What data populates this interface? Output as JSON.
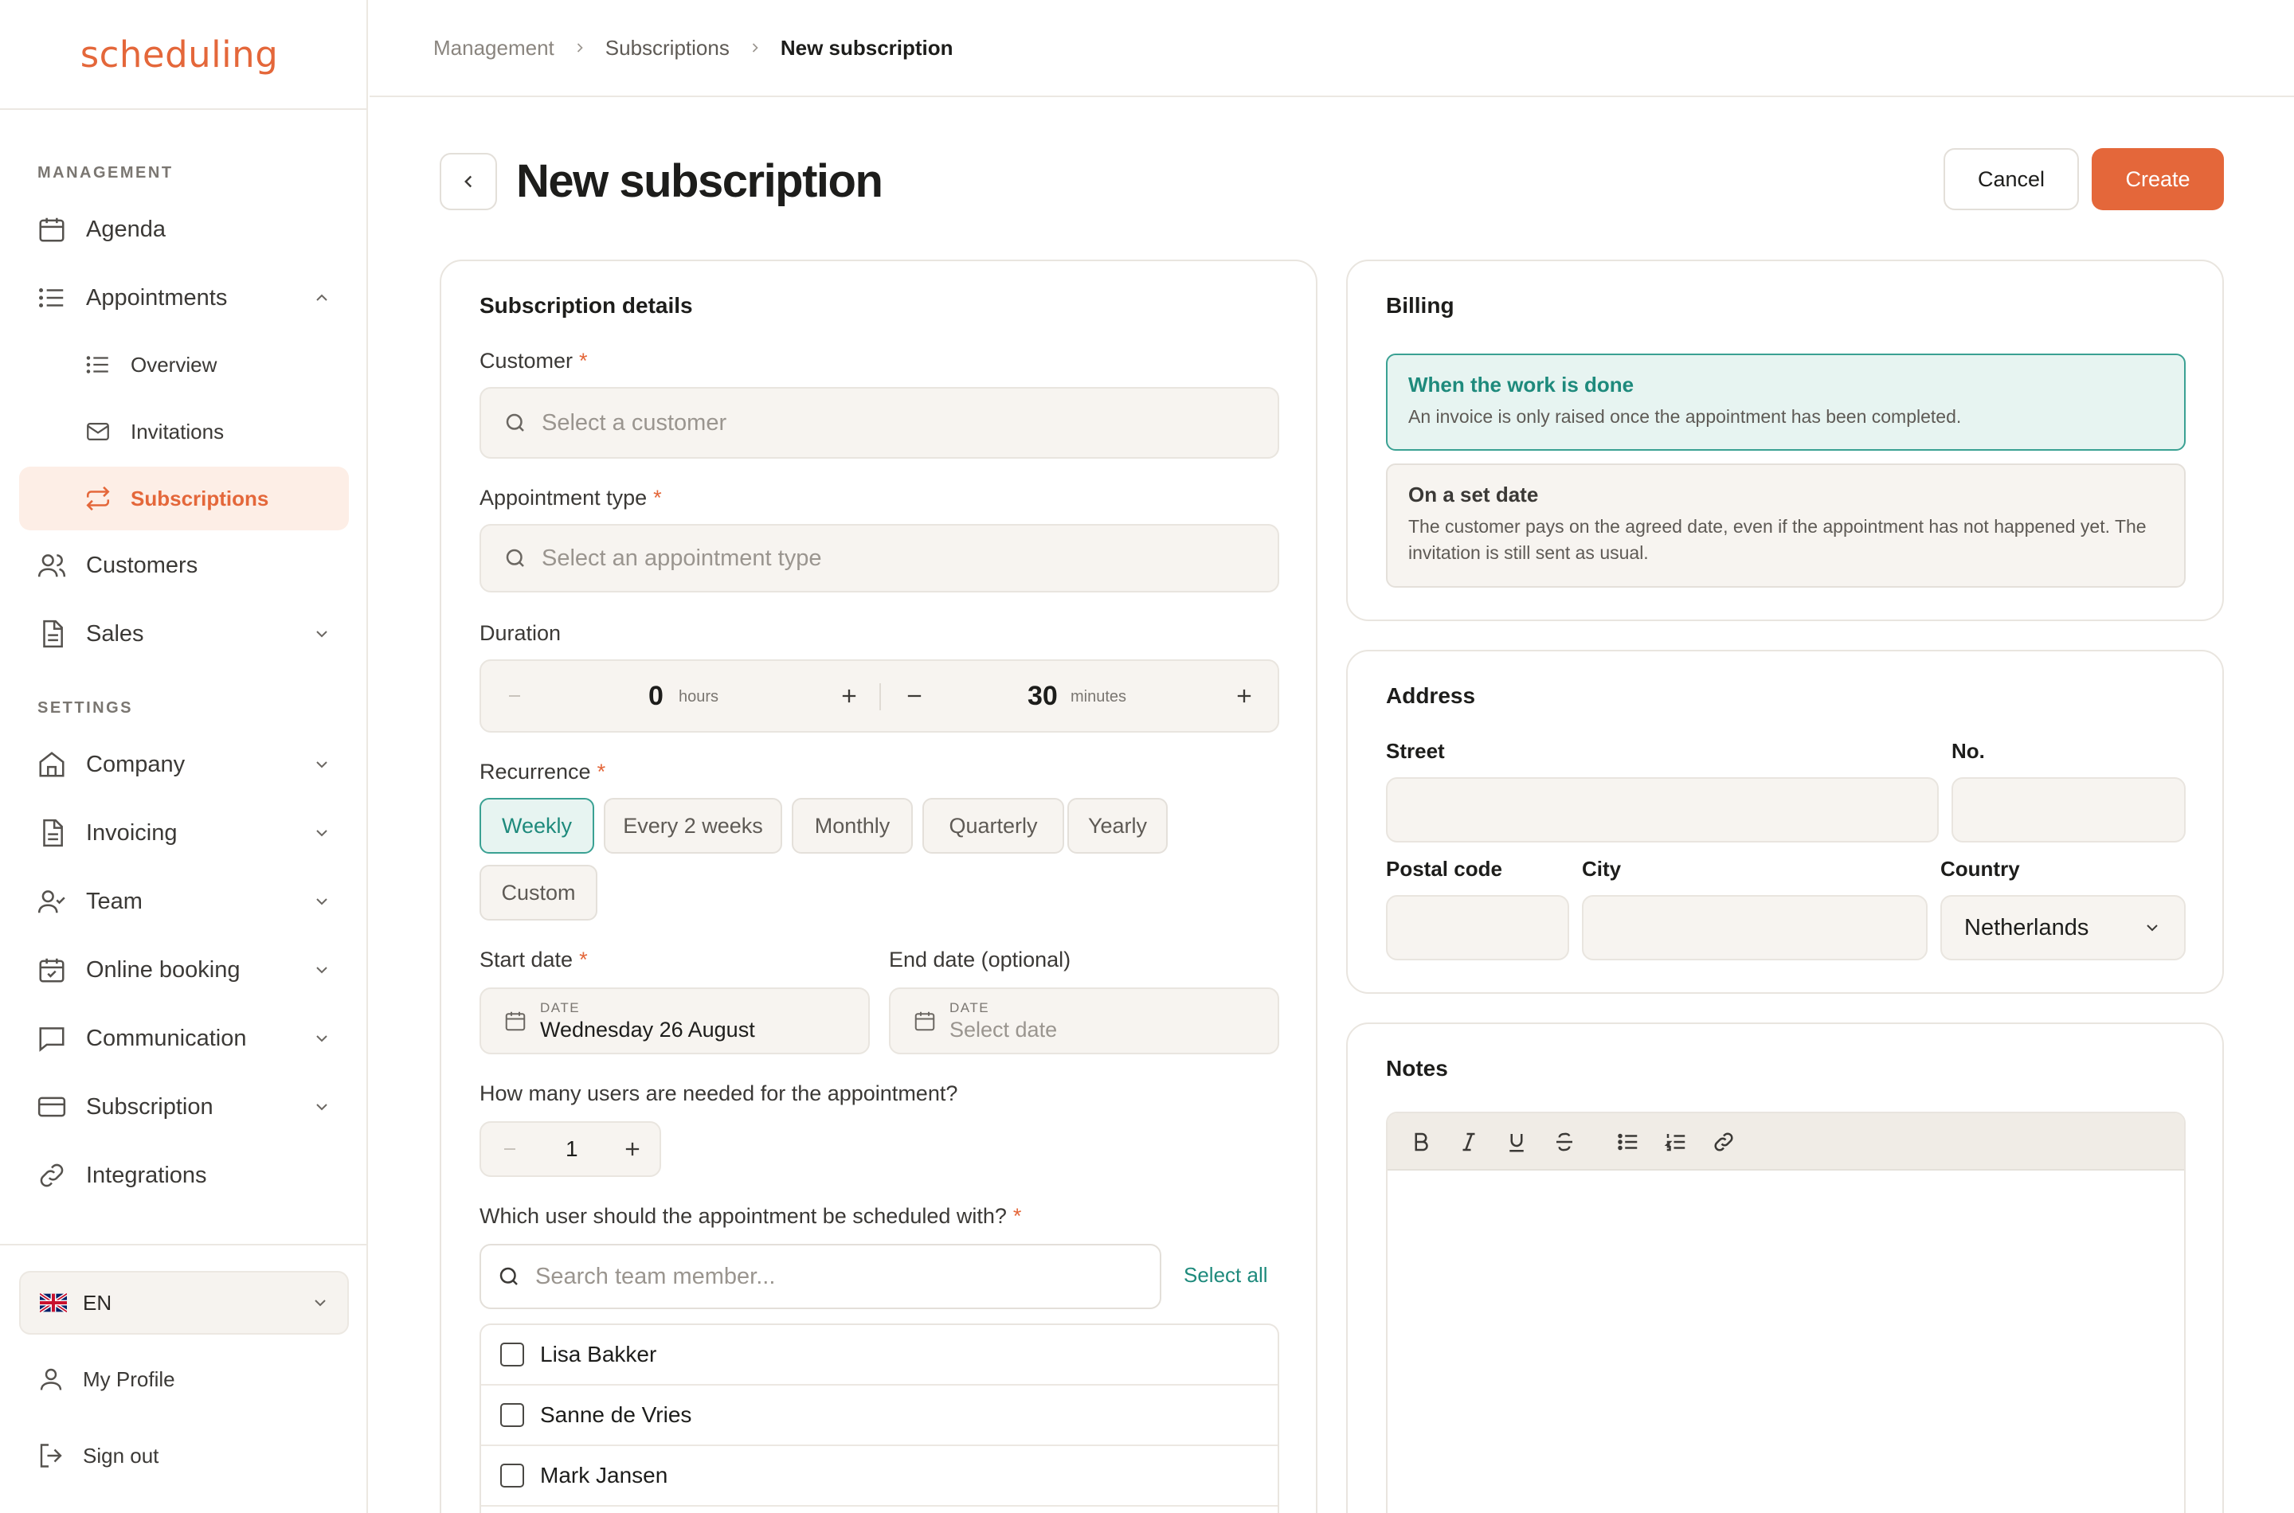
{
  "brand": {
    "logo_text": "scheduling"
  },
  "sidebar": {
    "management_label": "MANAGEMENT",
    "settings_label": "SETTINGS",
    "items": {
      "agenda": "Agenda",
      "appointments": "Appointments",
      "overview": "Overview",
      "invitations": "Invitations",
      "subscriptions": "Subscriptions",
      "customers": "Customers",
      "sales": "Sales",
      "company": "Company",
      "invoicing": "Invoicing",
      "team": "Team",
      "online_booking": "Online booking",
      "communication": "Communication",
      "subscription": "Subscription",
      "integrations": "Integrations"
    },
    "language": "EN",
    "my_profile": "My Profile",
    "sign_out": "Sign out"
  },
  "breadcrumb": [
    "Management",
    "Subscriptions",
    "New subscription"
  ],
  "header": {
    "title": "New subscription",
    "cancel": "Cancel",
    "create": "Create"
  },
  "details": {
    "title": "Subscription details",
    "customer_label": "Customer",
    "customer_placeholder": "Select a customer",
    "type_label": "Appointment type",
    "type_placeholder": "Select an appointment type",
    "duration_label": "Duration",
    "hours_value": "0",
    "hours_unit": "hours",
    "minutes_value": "30",
    "minutes_unit": "minutes",
    "recurrence_label": "Recurrence",
    "recurrence_options": [
      "Weekly",
      "Every 2 weeks",
      "Monthly",
      "Quarterly",
      "Yearly",
      "Custom"
    ],
    "recurrence_selected": "Weekly",
    "start_label": "Start date",
    "start_caption": "DATE",
    "start_value": "Wednesday 26 August",
    "end_label": "End date (optional)",
    "end_caption": "DATE",
    "end_placeholder": "Select date",
    "users_label": "How many users are needed for the appointment?",
    "users_value": "1",
    "which_user_label": "Which user should the appointment be scheduled with?",
    "search_placeholder": "Search team member...",
    "select_all": "Select all",
    "members": [
      "Lisa Bakker",
      "Sanne de Vries",
      "Mark Jansen"
    ]
  },
  "billing": {
    "title": "Billing",
    "options": [
      {
        "title": "When the work is done",
        "desc": "An invoice is only raised once the appointment has been completed.",
        "selected": true
      },
      {
        "title": "On a set date",
        "desc": "The customer pays on the agreed date, even if the appointment has not happened yet. The invitation is still sent as usual.",
        "selected": false
      }
    ]
  },
  "address": {
    "title": "Address",
    "street": "Street",
    "number": "No.",
    "postal": "Postal code",
    "city": "City",
    "country": "Country",
    "country_value": "Netherlands"
  },
  "notes": {
    "title": "Notes"
  },
  "colors": {
    "accent": "#e4673a",
    "teal": "#1e8a7c",
    "teal_bg": "#e7f4f1"
  }
}
